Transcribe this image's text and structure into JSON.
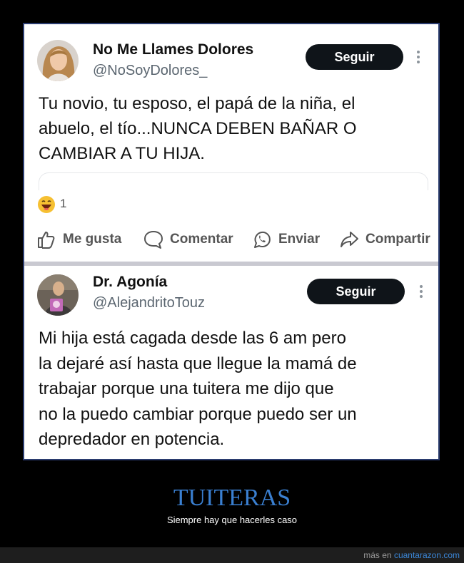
{
  "tweet1": {
    "name": "No Me Llames Dolores",
    "handle": "@NoSoyDolores_",
    "follow_label": "Seguir",
    "text_lines": [
      "Tu novio, tu esposo, el papá de la niña, el",
      "abuelo, el tío...NUNCA DEBEN BAÑAR O",
      "CAMBIAR A TU HIJA."
    ],
    "reaction_count": "1",
    "actions": {
      "like": "Me gusta",
      "comment": "Comentar",
      "send": "Enviar",
      "share": "Compartir"
    }
  },
  "tweet2": {
    "name": "Dr. Agonía",
    "handle": "@AlejandritoTouz",
    "follow_label": "Seguir",
    "text_lines": [
      "Mi hija está cagada desde las 6 am pero",
      "la dejaré así hasta que llegue la mamá de",
      "trabajar porque una tuitera me dijo que",
      "no la puedo cambiar porque puedo ser un",
      "depredador en potencia."
    ]
  },
  "caption": {
    "title": "TUITERAS",
    "subtitle": "Siempre hay que hacerles caso"
  },
  "footer": {
    "prefix": "más en ",
    "link": "cuantarazon.com"
  },
  "colors": {
    "accent": "#3a7fd0",
    "button": "#0f1419",
    "separator": "#c9c9d1"
  }
}
